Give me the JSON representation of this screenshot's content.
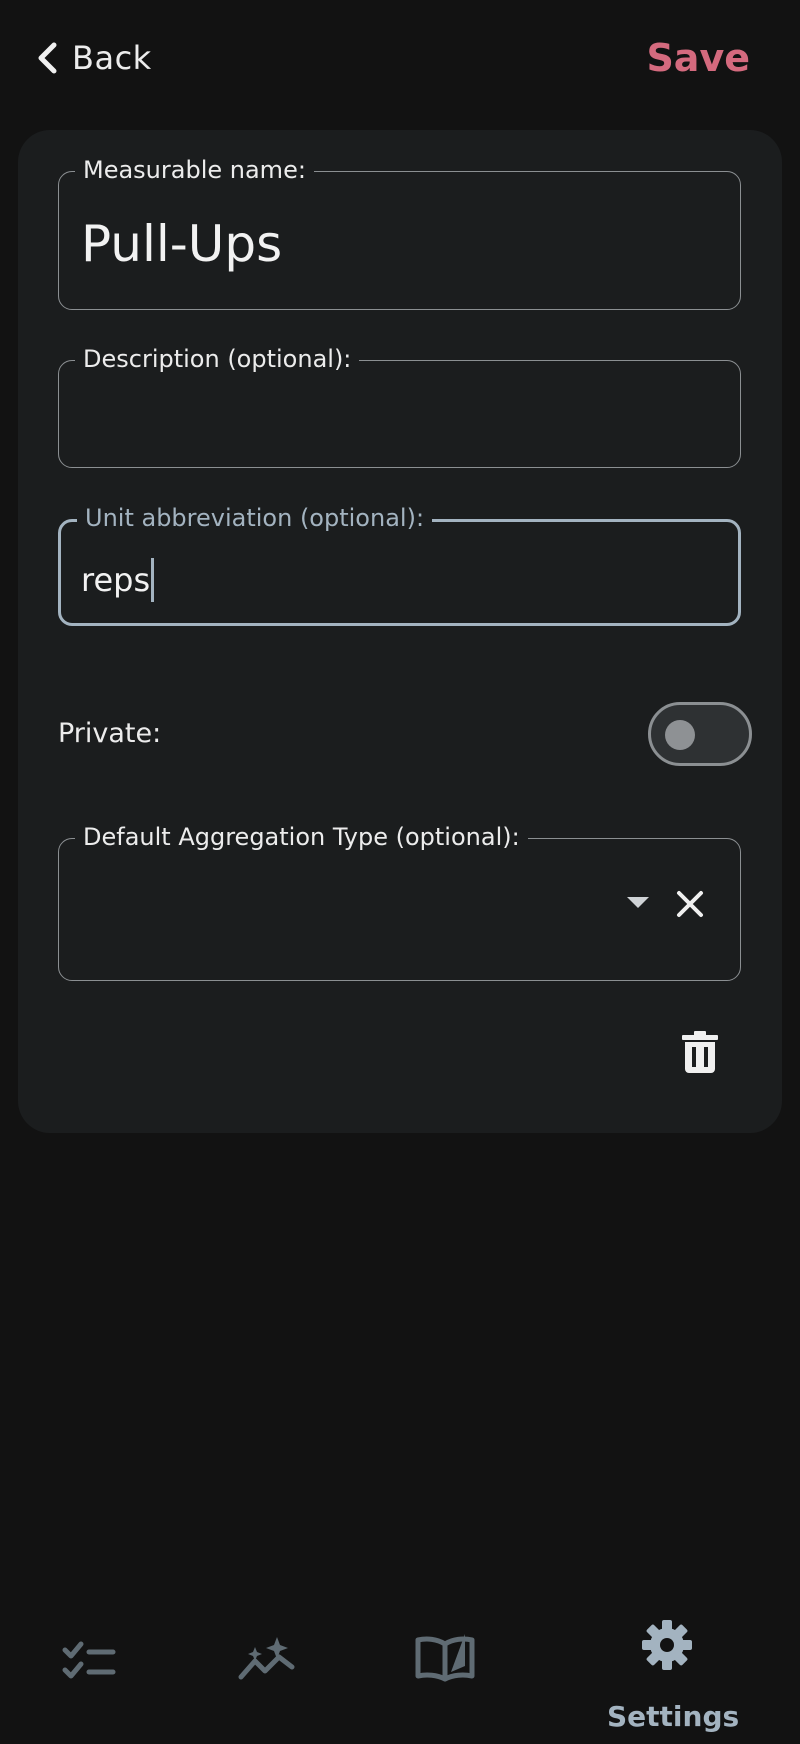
{
  "header": {
    "back_label": "Back",
    "save_label": "Save"
  },
  "form": {
    "name": {
      "label": "Measurable name:",
      "value": "Pull-Ups"
    },
    "description": {
      "label": "Description (optional):",
      "value": ""
    },
    "unit": {
      "label": "Unit abbreviation (optional):",
      "value": "reps"
    },
    "private": {
      "label": "Private:",
      "checked": false
    },
    "aggregation": {
      "label": "Default Aggregation Type (optional):",
      "value": ""
    }
  },
  "nav": {
    "items": [
      {
        "icon": "checklist-icon",
        "label": ""
      },
      {
        "icon": "trend-sparkle-icon",
        "label": ""
      },
      {
        "icon": "book-icon",
        "label": ""
      },
      {
        "icon": "gear-icon",
        "label": "Settings",
        "active": true
      }
    ]
  },
  "colors": {
    "background": "#121212",
    "card": "#1b1d1e",
    "accent": "#d46a7e",
    "focus": "#a3b3c0",
    "icon_inactive": "#5f6b73"
  }
}
